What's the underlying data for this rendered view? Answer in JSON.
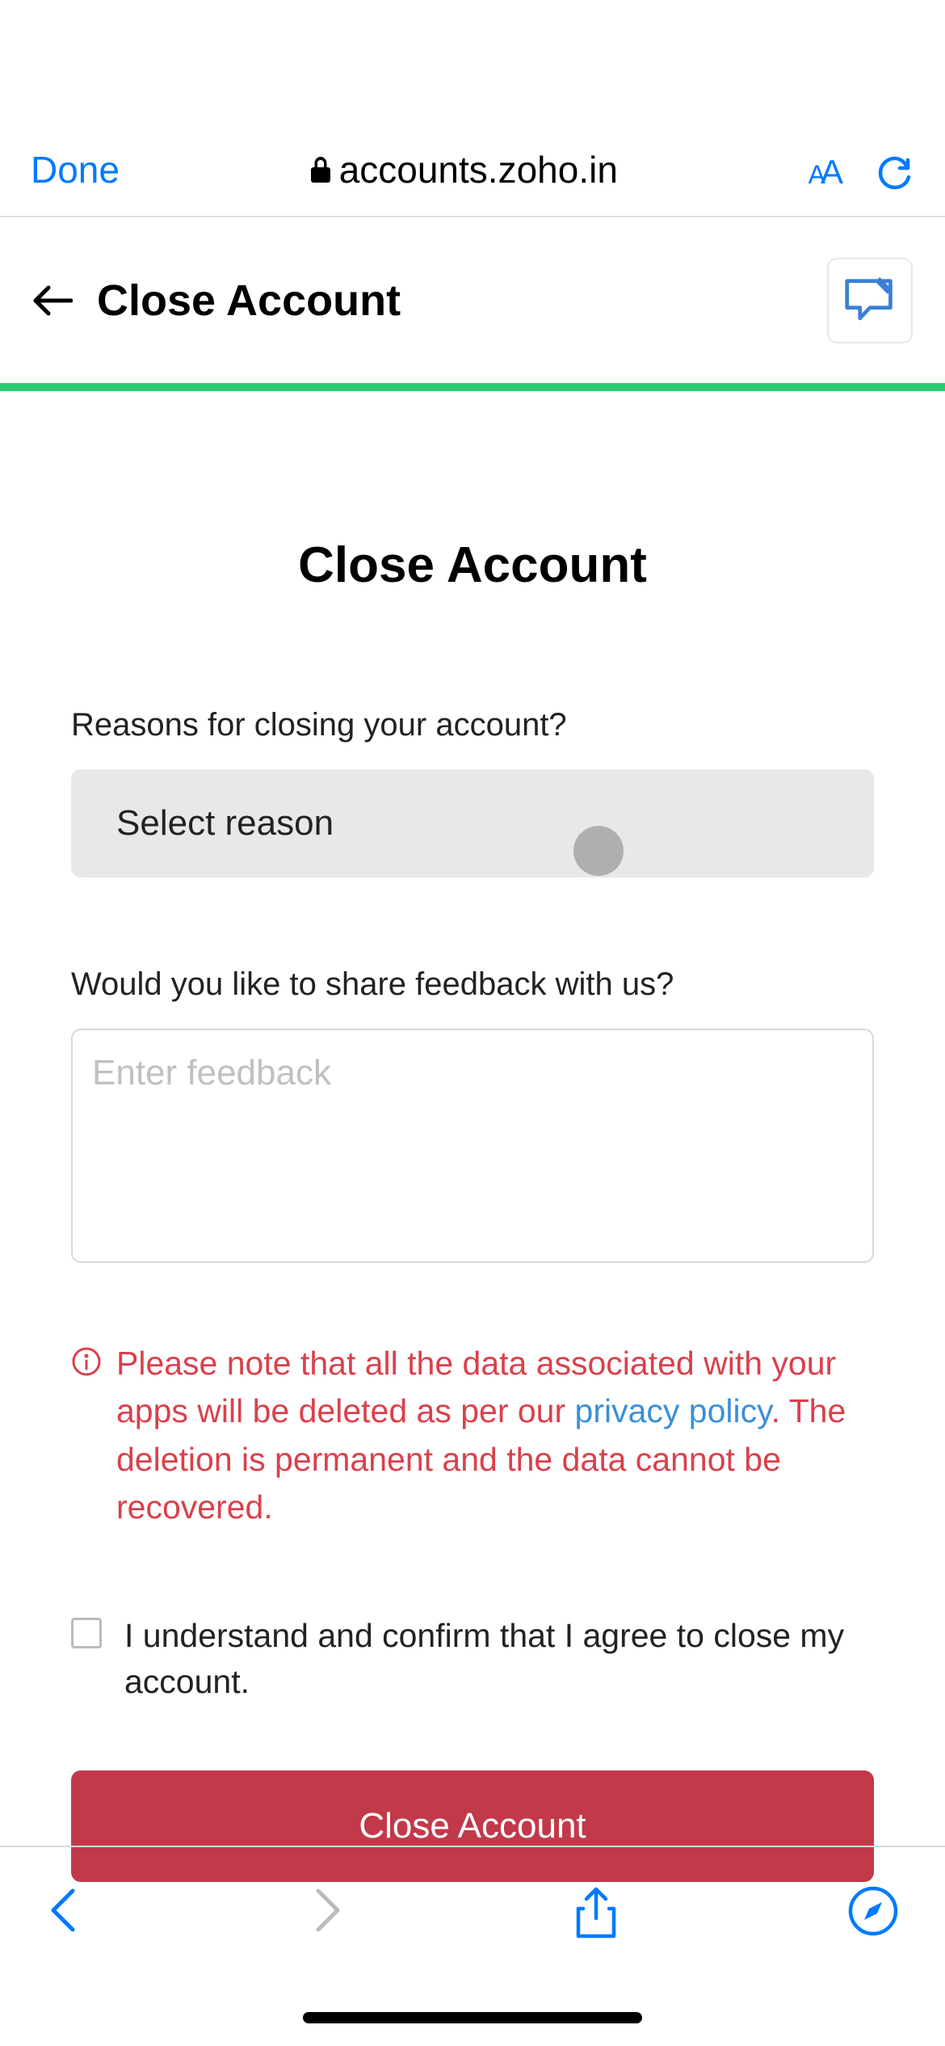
{
  "browser": {
    "done_label": "Done",
    "url": "accounts.zoho.in"
  },
  "header": {
    "title": "Close Account"
  },
  "main": {
    "title": "Close Account",
    "reason_label": "Reasons for closing your account?",
    "reason_placeholder": "Select reason",
    "feedback_label": "Would you like to share feedback with us?",
    "feedback_placeholder": "Enter feedback",
    "warning_part1": "Please note that all the data associated with your apps will be deleted as per our ",
    "privacy_link": "privacy policy",
    "warning_part2": ". The deletion is permanent and the data cannot be recovered.",
    "confirm_text": "I understand and confirm that I agree to close my account.",
    "close_button": "Close Account"
  },
  "colors": {
    "accent_blue": "#007AFF",
    "danger_red": "#d9414b",
    "button_red": "#c2394a",
    "progress_green": "#2ecc71"
  }
}
